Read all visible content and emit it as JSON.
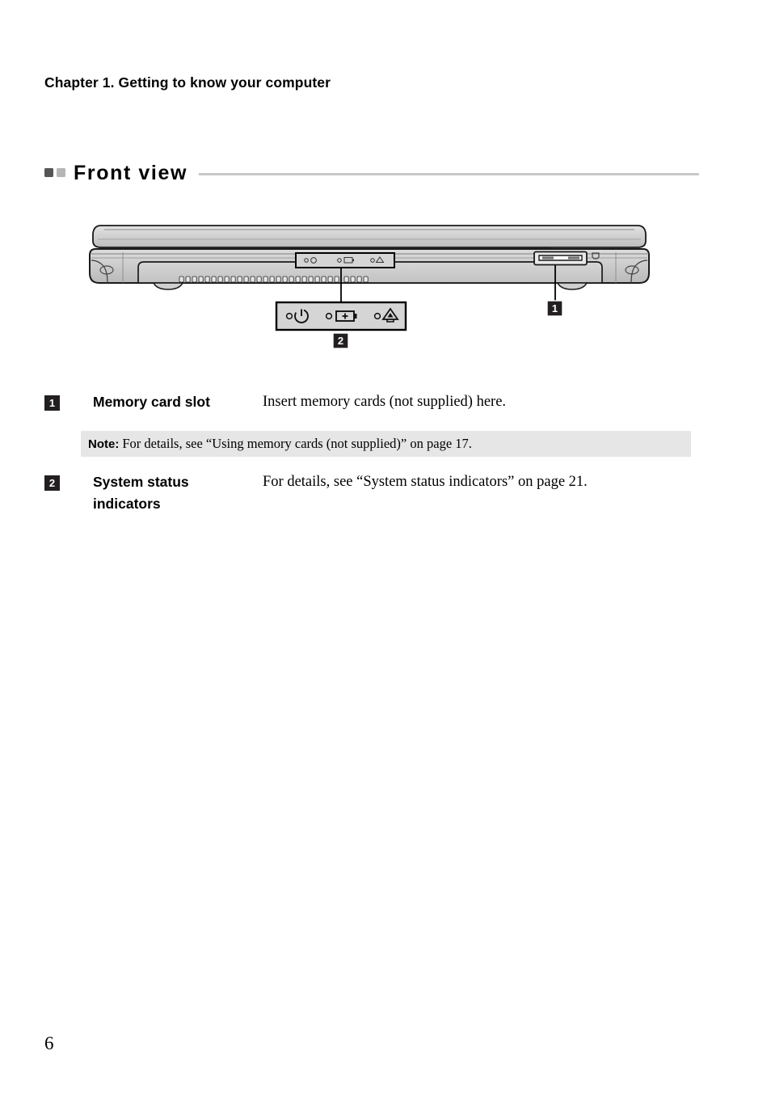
{
  "document": {
    "chapter_header": "Chapter 1. Getting to know your computer",
    "page_number": "6"
  },
  "section": {
    "title": "Front view",
    "bullet_dark_color": "#555555",
    "bullet_light_color": "#b5b5b5",
    "rule_color": "#c8c8c8"
  },
  "figure": {
    "alt": "Front view of laptop computer, closed lid",
    "callouts": [
      {
        "number": "1",
        "target": "memory-card-slot"
      },
      {
        "number": "2",
        "target": "system-status-indicators"
      }
    ],
    "indicator_icons": [
      {
        "name": "power-indicator-icon",
        "label": "power"
      },
      {
        "name": "battery-indicator-icon",
        "label": "battery"
      },
      {
        "name": "caps-lock-indicator-icon",
        "label": "caps lock"
      }
    ],
    "card_slot_icon": "memory-card-icon"
  },
  "items": [
    {
      "number": "1",
      "label": "Memory card slot",
      "description": "Insert memory cards (not supplied) here.",
      "note": {
        "label": "Note:",
        "text": "For details, see “Using memory cards (not supplied)” on page 17.",
        "background": "#e6e6e6"
      }
    },
    {
      "number": "2",
      "label_line1": "System status",
      "label_line2": "indicators",
      "description": "For details, see “System status indicators” on page 21."
    }
  ]
}
